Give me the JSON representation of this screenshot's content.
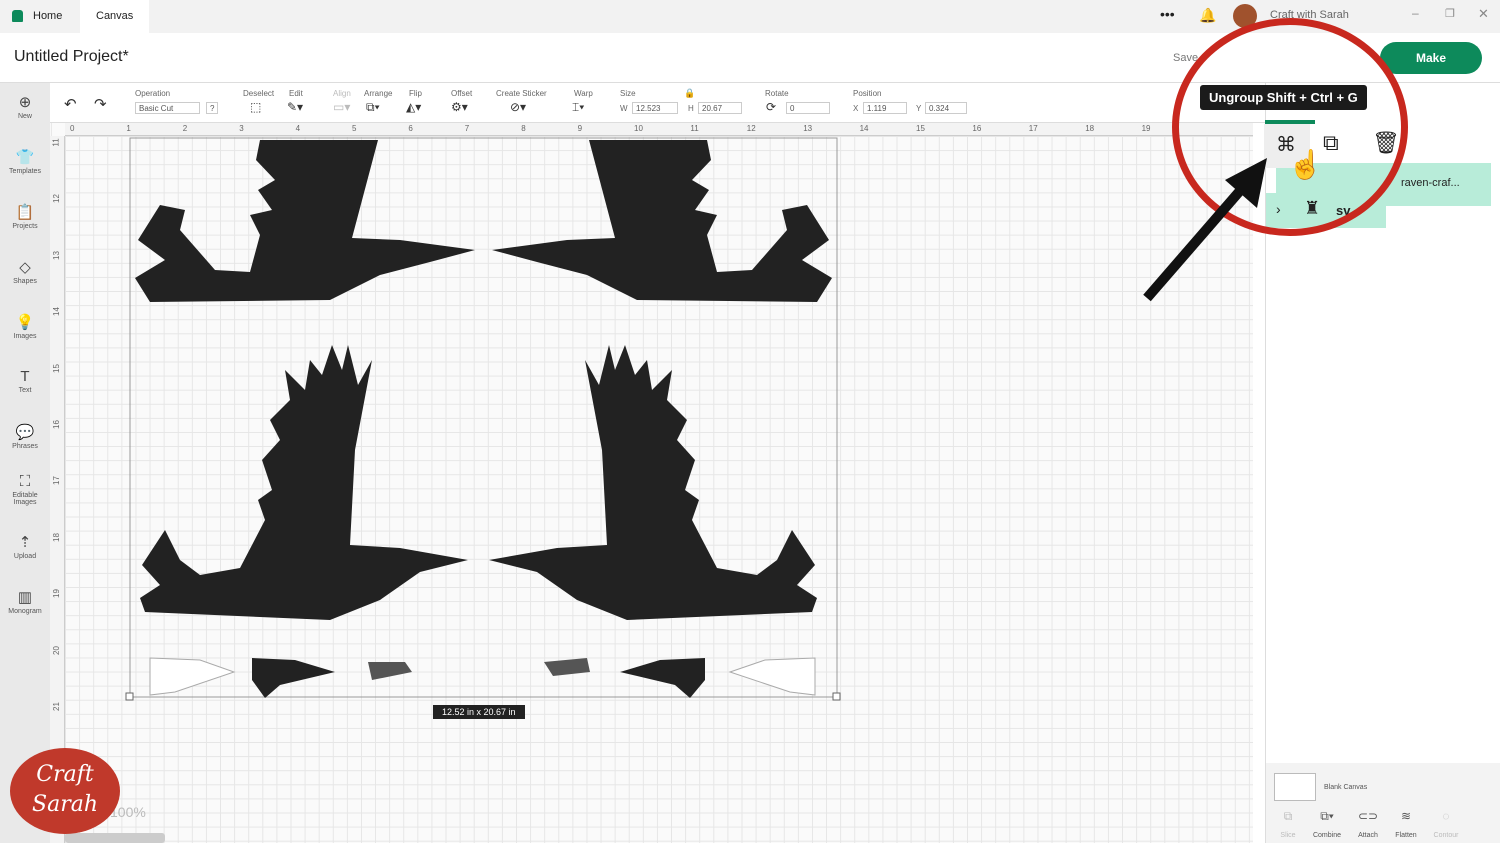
{
  "topbar": {
    "tabs": [
      {
        "label": "Home"
      },
      {
        "label": "Canvas"
      }
    ],
    "user": "Craft with Sarah"
  },
  "header": {
    "title": "Untitled Project*",
    "save": "Save",
    "make": "Make"
  },
  "toolbar": {
    "operation_label": "Operation",
    "operation_value": "Basic Cut",
    "help": "?",
    "deselect": "Deselect",
    "edit": "Edit",
    "align": "Align",
    "arrange": "Arrange",
    "flip": "Flip",
    "offset": "Offset",
    "create_sticker": "Create Sticker",
    "warp": "Warp",
    "size": "Size",
    "w_label": "W",
    "w": "12.523",
    "h_label": "H",
    "h": "20.67",
    "rotate": "Rotate",
    "rotate_value": "0",
    "position": "Position",
    "x_label": "X",
    "x": "1.119",
    "y_label": "Y",
    "y": "0.324"
  },
  "sidebar": {
    "items": [
      {
        "label": "New",
        "icon": "plus-circle"
      },
      {
        "label": "Templates",
        "icon": "shirt"
      },
      {
        "label": "Projects",
        "icon": "clipboard"
      },
      {
        "label": "Shapes",
        "icon": "shapes"
      },
      {
        "label": "Images",
        "icon": "bulb"
      },
      {
        "label": "Text",
        "icon": "T"
      },
      {
        "label": "Phrases",
        "icon": "speech"
      },
      {
        "label": "Editable Images",
        "icon": "edit-image"
      },
      {
        "label": "Upload",
        "icon": "upload"
      },
      {
        "label": "Monogram",
        "icon": "monogram"
      }
    ]
  },
  "ruler": {
    "top": [
      "0",
      "1",
      "2",
      "3",
      "4",
      "5",
      "6",
      "7",
      "8",
      "9",
      "10",
      "11",
      "12",
      "13",
      "14",
      "15",
      "16",
      "17",
      "18",
      "19"
    ],
    "left": [
      "11",
      "12",
      "13",
      "14",
      "15",
      "16",
      "17",
      "18",
      "19",
      "20",
      "21"
    ]
  },
  "canvas": {
    "dimensions": "12.52  in x 20.67  in",
    "zoom": "100%"
  },
  "tooltip": "Ungroup Shift + Ctrl + G",
  "layers": {
    "group_name": "raven-craf...",
    "item_name": "sv"
  },
  "bottom": {
    "blank_canvas": "Blank Canvas",
    "actions": [
      "Slice",
      "Combine",
      "Attach",
      "Flatten",
      "Contour"
    ]
  },
  "logo": "Craft with Sarah",
  "colors": {
    "accent": "#0d8a5b",
    "highlight_ring": "#c8281e",
    "layer_bg": "#b8ecd9"
  }
}
